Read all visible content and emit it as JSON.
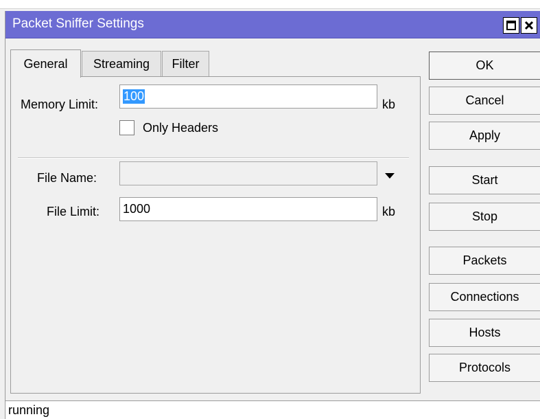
{
  "window": {
    "title": "Packet Sniffer Settings",
    "maximize_icon": "maximize-icon",
    "close_icon": "close-icon",
    "titlebar_color": "#6c6cd3"
  },
  "tabs": [
    {
      "label": "General",
      "active": true
    },
    {
      "label": "Streaming",
      "active": false
    },
    {
      "label": "Filter",
      "active": false
    }
  ],
  "general": {
    "memory_limit_label": "Memory Limit:",
    "memory_limit_value": "100",
    "memory_limit_unit": "kb",
    "only_headers_label": "Only Headers",
    "only_headers_checked": false,
    "file_name_label": "File Name:",
    "file_name_value": "",
    "file_limit_label": "File Limit:",
    "file_limit_value": "1000",
    "file_limit_unit": "kb"
  },
  "buttons": {
    "ok": "OK",
    "cancel": "Cancel",
    "apply": "Apply",
    "start": "Start",
    "stop": "Stop",
    "packets": "Packets",
    "connections": "Connections",
    "hosts": "Hosts",
    "protocols": "Protocols"
  },
  "status": {
    "text": "running"
  }
}
